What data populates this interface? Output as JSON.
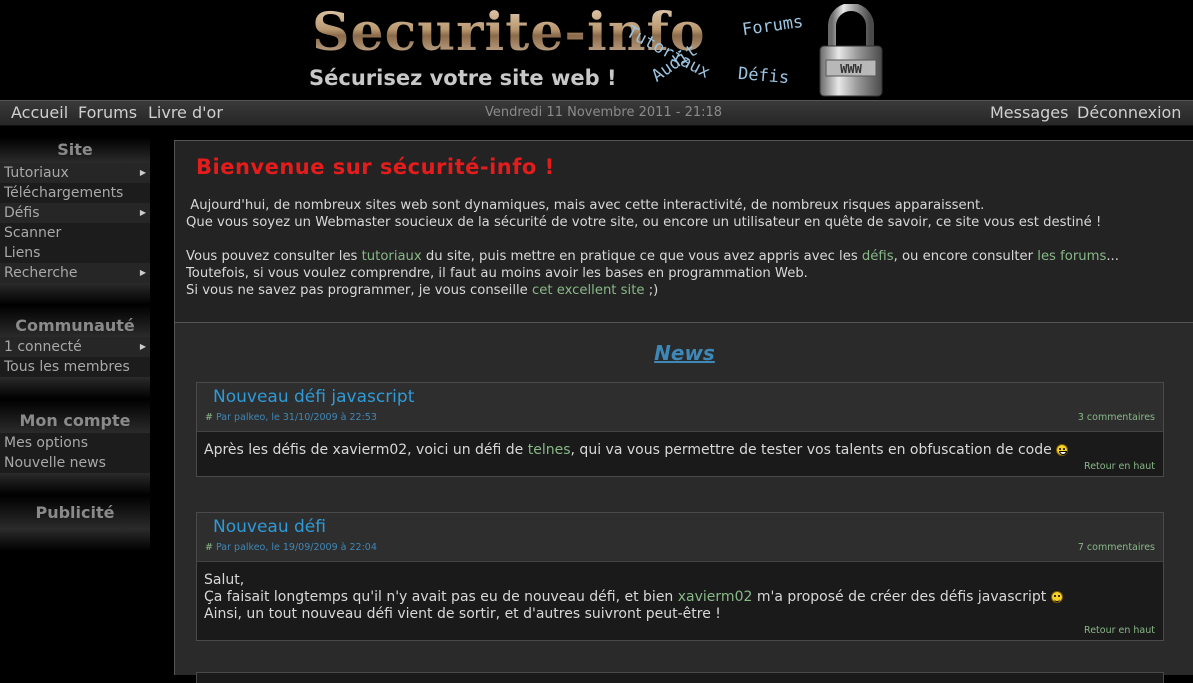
{
  "header": {
    "logo": "Securite-info",
    "slogan": "Sécurisez votre site web !",
    "floating_words": [
      "Tutoriaux",
      "Forums",
      "Audit",
      "Défis"
    ],
    "padlock_label": "WWW"
  },
  "menubar": {
    "left": [
      "Accueil",
      "Forums",
      "Livre d'or"
    ],
    "date": "Vendredi 11 Novembre 2011 - 21:18",
    "right": [
      "Messages",
      "Déconnexion"
    ]
  },
  "sidebar": {
    "site": {
      "title": "Site",
      "items": [
        "Tutoriaux",
        "Téléchargements",
        "Défis",
        "Scanner",
        "Liens",
        "Recherche"
      ]
    },
    "communaute": {
      "title": "Communauté",
      "items": [
        "1 connecté",
        "Tous les membres"
      ]
    },
    "compte": {
      "title": "Mon compte",
      "items": [
        "Mes options",
        "Nouvelle news"
      ]
    },
    "pub": {
      "title": "Publicité"
    }
  },
  "welcome": {
    "title": "Bienvenue sur sécurité-info !",
    "line1": " Aujourd'hui, de nombreux sites web sont dynamiques, mais avec cette interactivité, de nombreux risques apparaissent.",
    "line2": "Que vous soyez un Webmaster soucieux de la sécurité de votre site, ou encore un utilisateur en quête de savoir, ce site vous est destiné !",
    "p2a": "Vous pouvez consulter les ",
    "link_tutoriaux": "tutoriaux",
    "p2b": " du site, puis mettre en pratique ce que vous avez appris avec les ",
    "link_defis": "défis",
    "p2c": ", ou encore consulter ",
    "link_forums": "les forums",
    "p2d": "...",
    "line4": "Toutefois, si vous voulez comprendre, il faut au moins avoir les bases en programmation Web.",
    "p5a": "Si vous ne savez pas programmer, je vous conseille ",
    "link_site": "cet excellent site",
    "p5b": " ;)"
  },
  "news": {
    "heading": "News",
    "items": [
      {
        "title": "Nouveau défi javascript",
        "hash": "#",
        "meta": " Par palkeo, le 31/10/2009 à 22:53",
        "comments": "3 commentaires",
        "body_a": "Après les défis de xavierm02, voici un défi de ",
        "body_link": "telnes",
        "body_b": ", qui va vous permettre de tester vos talents en obfuscation de code ",
        "back": "Retour en haut"
      },
      {
        "title": "Nouveau défi",
        "hash": "#",
        "meta": " Par palkeo, le 19/09/2009 à 22:04",
        "comments": "7 commentaires",
        "line1": "Salut,",
        "line2a": "Ça faisait longtemps qu'il n'y avait pas eu de nouveau défi, et bien ",
        "line2_link": "xavierm02",
        "line2b": " m'a proposé de créer des défis javascript ",
        "line3": "Ainsi, un tout nouveau défi vient de sortir, et d'autres suivront peut-être !",
        "back": "Retour en haut"
      }
    ]
  }
}
